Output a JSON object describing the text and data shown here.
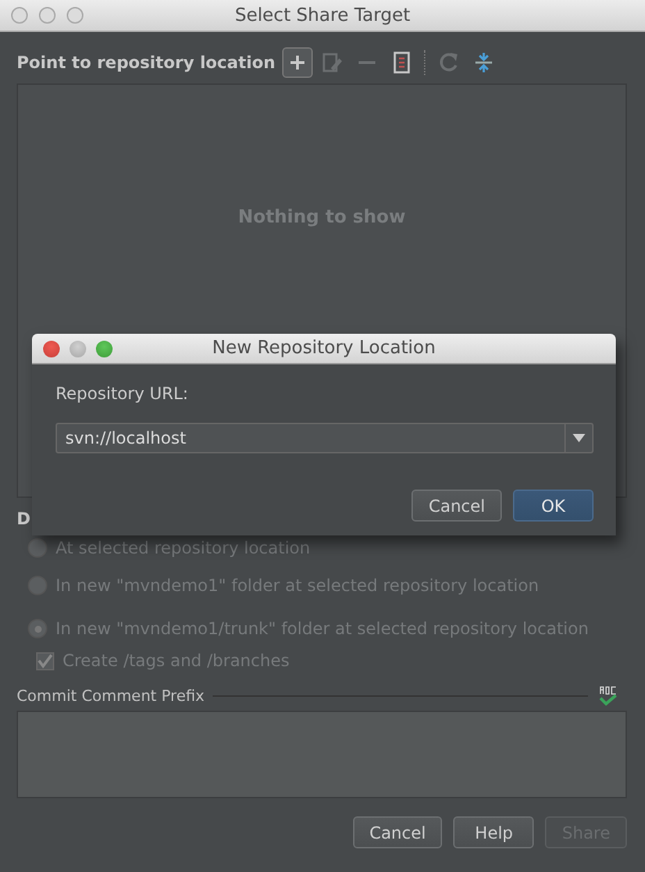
{
  "window": {
    "title": "Select Share Target"
  },
  "toolbar": {
    "label": "Point to repository location",
    "tools": [
      {
        "kind": "add",
        "disabled": false
      },
      {
        "kind": "edit",
        "disabled": true
      },
      {
        "kind": "remove",
        "disabled": true
      },
      {
        "kind": "document",
        "disabled": false
      },
      {
        "kind": "refresh",
        "disabled": true
      },
      {
        "kind": "collapse",
        "disabled": false
      }
    ]
  },
  "list": {
    "empty_text": "Nothing to show"
  },
  "section_label": "D",
  "options": [
    {
      "label": "At selected repository location",
      "selected": false,
      "disabled": true
    },
    {
      "label": "In new \"mvndemo1\" folder at selected repository location",
      "selected": false,
      "disabled": true
    },
    {
      "label": "In new \"mvndemo1/trunk\" folder at selected repository location",
      "selected": true,
      "disabled": true
    }
  ],
  "checkbox": {
    "label": "Create /tags and /branches",
    "checked": true,
    "disabled": true
  },
  "comment": {
    "label": "Commit Comment Prefix"
  },
  "buttons": [
    {
      "label": "Cancel",
      "disabled": false
    },
    {
      "label": "Help",
      "disabled": false
    },
    {
      "label": "Share",
      "disabled": true
    }
  ],
  "popup": {
    "title": "New Repository Location",
    "field_label": "Repository URL:",
    "url": "svn://localhost",
    "buttons": [
      {
        "label": "Cancel",
        "default": false
      },
      {
        "label": "OK",
        "default": true
      }
    ]
  }
}
